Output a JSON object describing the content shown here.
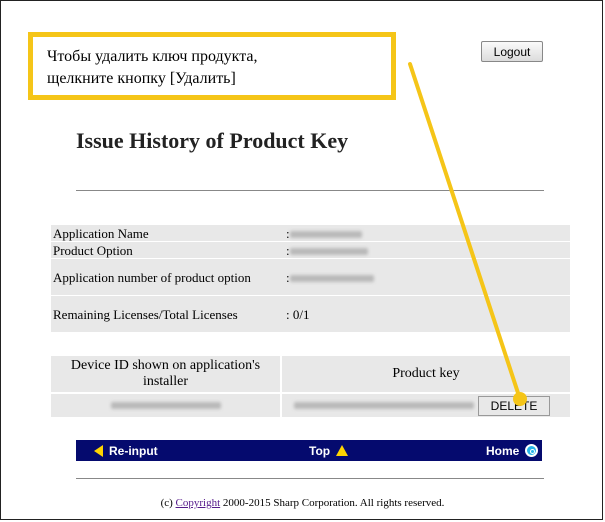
{
  "logout_label": "Logout",
  "callout": {
    "line1": "Чтобы удалить ключ продукта,",
    "line2": "щелкните кнопку [Удалить]"
  },
  "page_title": "Issue History of Product Key",
  "info_rows": [
    {
      "label": "Application Name",
      "value": ":"
    },
    {
      "label": "Product Option",
      "value": ":"
    },
    {
      "label": "Application number of product option",
      "value": ":"
    },
    {
      "label": "Remaining Licenses/Total Licenses",
      "value": ": 0/1"
    }
  ],
  "device_table": {
    "header_device": "Device ID shown on application's installer",
    "header_key": "Product key",
    "delete_label": "DELETE"
  },
  "nav": {
    "reinput": "Re-input",
    "top": "Top",
    "home": "Home"
  },
  "footer": {
    "prefix": "(c) ",
    "link": "Copyright",
    "suffix": " 2000-2015 Sharp Corporation. All rights reserved."
  },
  "colors": {
    "callout_border": "#f5c518",
    "navbar": "#050a6e",
    "arrow": "#f5c518"
  }
}
